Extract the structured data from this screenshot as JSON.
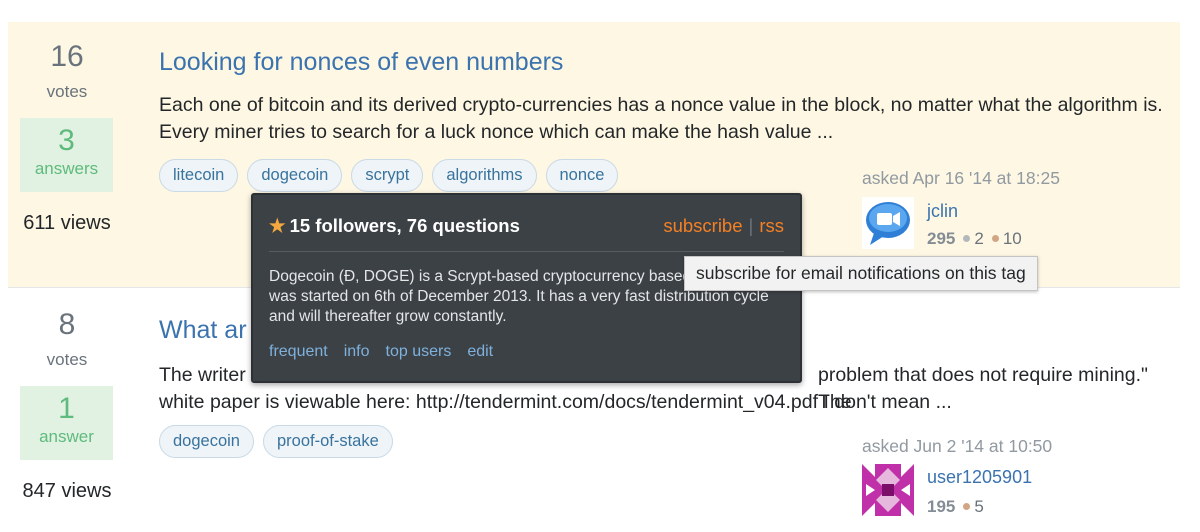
{
  "questions": [
    {
      "votes": "16",
      "votes_label": "votes",
      "answers": "3",
      "answers_label": "answers",
      "views": "611 views",
      "title": "Looking for nonces of even numbers",
      "excerpt": "Each one of bitcoin and its derived crypto-currencies has a nonce value in the block, no matter what the algorithm is. Every miner tries to search for a luck nonce which can make the hash value ...",
      "tags": [
        "litecoin",
        "dogecoin",
        "scrypt",
        "algorithms",
        "nonce"
      ],
      "asked": "asked Apr 16 '14 at 18:25",
      "user": {
        "name": "jclin",
        "rep": "295",
        "silver": "2",
        "bronze": "10",
        "avatar": "speech-bubble-video-avatar"
      }
    },
    {
      "votes": "8",
      "votes_label": "votes",
      "answers": "1",
      "answers_label": "answer",
      "views": "847 views",
      "title": "What ar",
      "excerpt_start": "The writer",
      "excerpt_end": "problem that does not require mining.\" The",
      "excerpt_line2": "white paper is viewable here: http://tendermint.com/docs/tendermint_v04.pdf I don't mean ...",
      "tags": [
        "dogecoin",
        "proof-of-stake"
      ],
      "asked": "asked Jun 2 '14 at 10:50",
      "user": {
        "name": "user1205901",
        "rep": "195",
        "bronze": "5",
        "avatar": "purple-identicon-avatar"
      }
    }
  ],
  "tag_popup": {
    "star_icon": "star-icon",
    "header": "15 followers, 76 questions",
    "subscribe": "subscribe",
    "separator": "|",
    "rss": "rss",
    "description": "Dogecoin (Đ, DOGE) is a Scrypt-based cryptocurrency based on Litecoin. It was started on 6th of December 2013. It has a very fast distribution cycle and will thereafter grow constantly.",
    "links": [
      "frequent",
      "info",
      "top users",
      "edit"
    ]
  },
  "tooltip": "subscribe for email notifications on this tag",
  "colors": {
    "highlight_bg": "#fdf7e3",
    "link": "#3b73af",
    "answered_bg": "#e2f2e2",
    "answered_text": "#5eba7d",
    "popup_bg": "#3c4146",
    "popup_action": "#f48024"
  }
}
